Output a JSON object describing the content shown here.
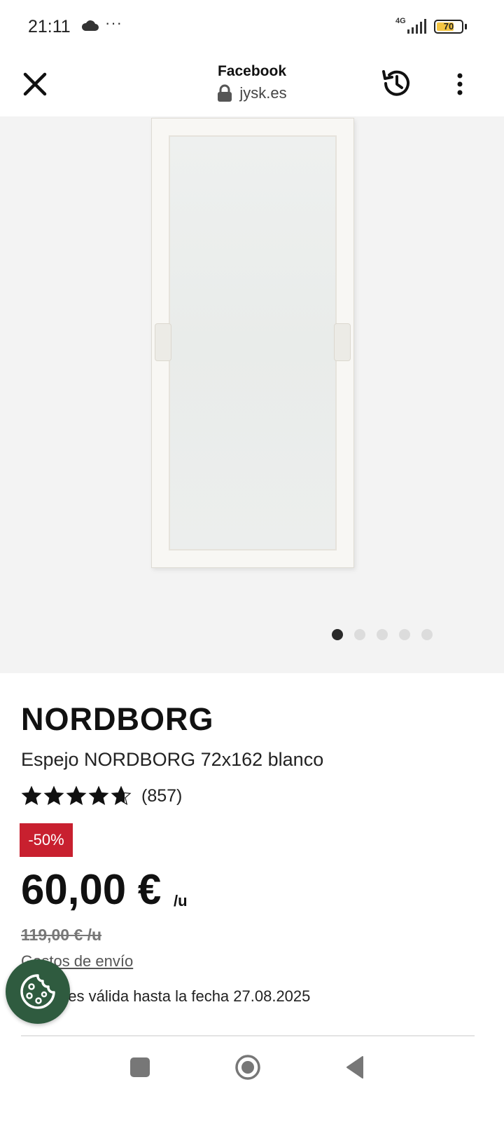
{
  "status_bar": {
    "time": "21:11",
    "more_indicator": "···",
    "network": "4G",
    "battery": "70",
    "battery_level_percent": 70
  },
  "browser": {
    "title": "Facebook",
    "url": "jysk.es"
  },
  "gallery": {
    "image_count": 5,
    "active_index": 0
  },
  "product": {
    "brand": "NORDBORG",
    "name": "Espejo NORDBORG 72x162 blanco",
    "rating_stars": 4.7,
    "rating_count": "(857)",
    "discount_badge": "-50%",
    "price": "60,00 €",
    "price_unit": "/u",
    "old_price": "119,00 € /u",
    "shipping_link": "Gastos de envío",
    "offer_validity": "Oferta es válida hasta la fecha 27.08.2025"
  },
  "colors": {
    "discount_red": "#c8202f",
    "cookie_green": "#2f5b3f",
    "battery_yellow": "#f4c542"
  },
  "icons": {
    "close": "close-icon",
    "lock": "lock-icon",
    "history": "history-icon",
    "menu": "more-vert-icon",
    "cookie": "cookie-icon",
    "star": "star-icon"
  }
}
